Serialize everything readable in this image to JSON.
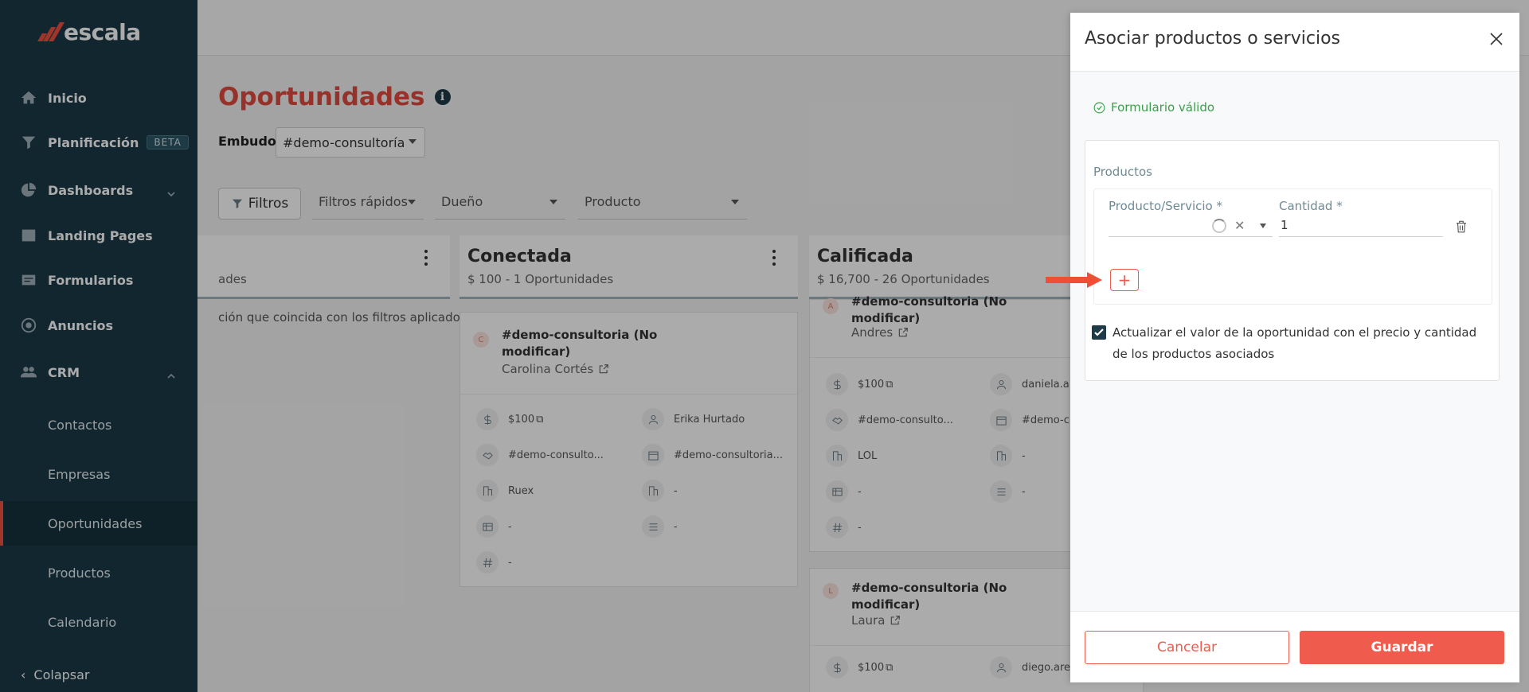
{
  "sidebar": {
    "logo_text": "escala",
    "items": [
      {
        "label": "Inicio",
        "icon": "home-icon"
      },
      {
        "label": "Planificación",
        "icon": "funnel-icon",
        "badge": "BETA"
      },
      {
        "label": "Dashboards",
        "icon": "pie-chart-icon"
      },
      {
        "label": "Landing Pages",
        "icon": "landing-page-icon"
      },
      {
        "label": "Formularios",
        "icon": "form-icon"
      },
      {
        "label": "Anuncios",
        "icon": "ads-icon"
      },
      {
        "label": "CRM",
        "icon": "people-icon"
      }
    ],
    "crm_sub": [
      "Contactos",
      "Empresas",
      "Oportunidades",
      "Productos",
      "Calendario"
    ],
    "active_sub": "Oportunidades",
    "collapse_label": "Colapsar"
  },
  "page": {
    "title": "Oportunidades",
    "embudo_label": "Embudo",
    "embudo_value": "#demo-consultoría",
    "filters_button": "Filtros",
    "filter_fields": [
      "Filtros rápidos",
      "Dueño",
      "Producto"
    ]
  },
  "kanban": {
    "col0": {
      "subtitle": "ades",
      "empty_message": "ción que coincida con los filtros aplicados"
    },
    "col1": {
      "title": "Conectada",
      "subtitle": "$ 100 - 1 Oportunidades",
      "card": {
        "avatar": "C",
        "title": "#demo-consultoria (No modificar)",
        "owner": "Carolina Cortés",
        "fields": [
          "$100",
          "Erika Hurtado",
          "#demo-consulto...",
          "#demo-consultoria...",
          "Ruex",
          "-",
          "-",
          "-",
          "-"
        ]
      }
    },
    "col2": {
      "title": "Calificada",
      "subtitle": "$ 16,700 - 26 Oportunidades",
      "card1": {
        "avatar": "A",
        "title": "#demo-consultoria (No modificar)",
        "owner": "Andres",
        "fields": [
          "$100",
          "daniela.a",
          "#demo-consulto...",
          "#demo-c",
          "LOL",
          "-",
          "-",
          "-",
          "-"
        ]
      },
      "card2": {
        "avatar": "L",
        "title": "#demo-consultoria (No modificar)",
        "owner": "Laura",
        "fields": [
          "$100",
          "diego.are"
        ]
      }
    }
  },
  "panel": {
    "title": "Asociar productos o servicios",
    "valid_message": "Formulario válido",
    "products_label": "Productos",
    "product_field_label": "Producto/Servicio *",
    "quantity_label": "Cantidad *",
    "quantity_value": "1",
    "checkbox_checked": true,
    "checkbox_text": "Actualizar el valor de la oportunidad con el precio y cantidad de los productos asociados",
    "cancel_label": "Cancelar",
    "save_label": "Guardar"
  },
  "colors": {
    "brand_red": "#ef5b4c",
    "sidebar_bg": "#1c3a48",
    "valid_green": "#3aa04a",
    "arrow": "#ef4f35"
  }
}
